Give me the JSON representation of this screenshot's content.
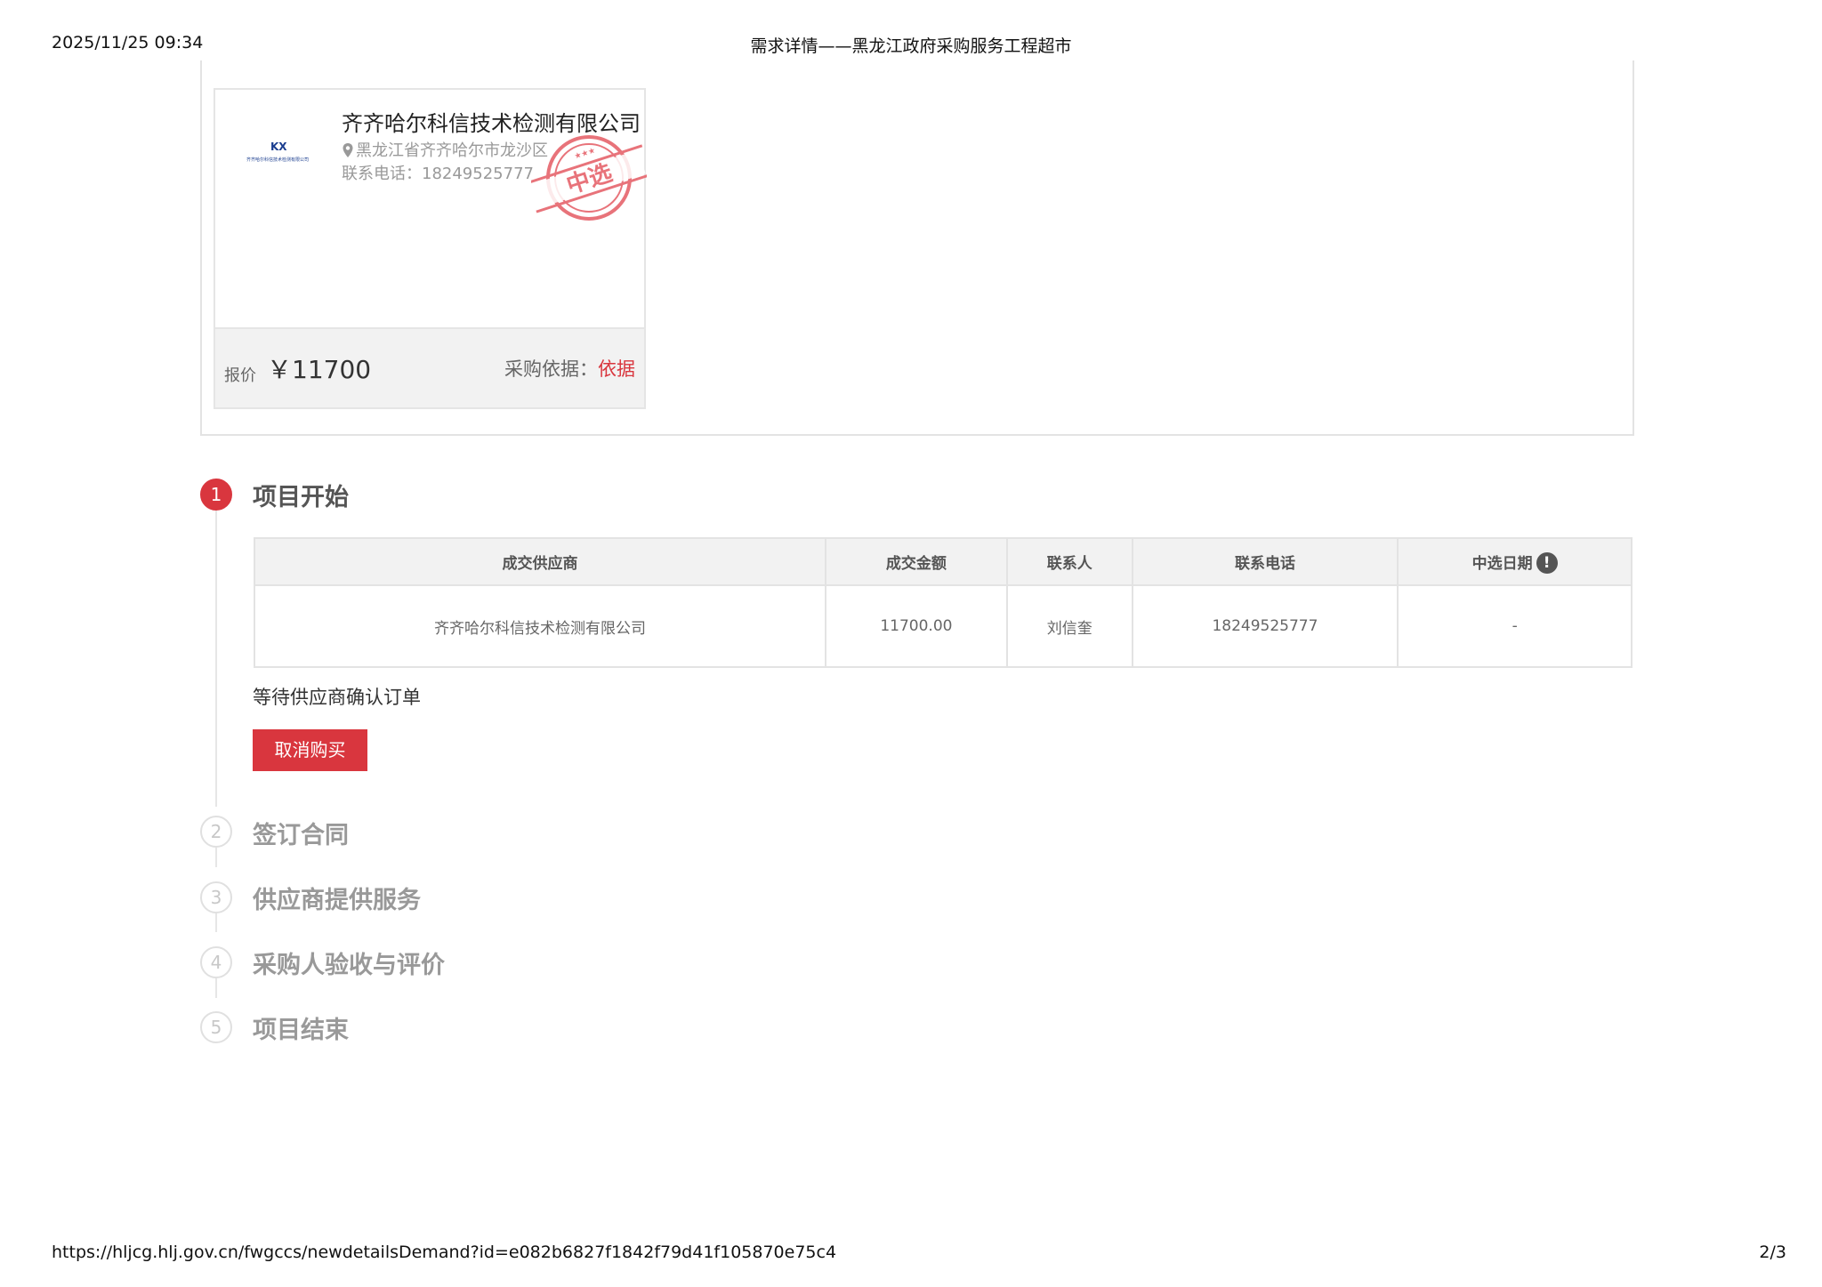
{
  "print_header": {
    "datetime": "2025/11/25 09:34",
    "title": "需求详情——黑龙江政府采购服务工程超市"
  },
  "print_footer": {
    "url": "https://hljcg.hlj.gov.cn/fwgccs/newdetailsDemand?id=e082b6827f1842f79d41f105870e75c4",
    "page": "2/3"
  },
  "supplier_card": {
    "logo_text": "KX",
    "logo_caption": "齐齐哈尔科信技术检测有限公司",
    "name": "齐齐哈尔科信技术检测有限公司",
    "address": "黑龙江省齐齐哈尔市龙沙区",
    "phone": "联系电话：18249525777",
    "stamp_text": "中选",
    "price_label": "报价",
    "price_value": "￥11700",
    "basis_label": "采购依据：",
    "basis_link": "依据"
  },
  "steps": [
    {
      "num": "1",
      "title": "项目开始",
      "active": true
    },
    {
      "num": "2",
      "title": "签订合同",
      "active": false
    },
    {
      "num": "3",
      "title": "供应商提供服务",
      "active": false
    },
    {
      "num": "4",
      "title": "采购人验收与评价",
      "active": false
    },
    {
      "num": "5",
      "title": "项目结束",
      "active": false
    }
  ],
  "deal_table": {
    "headers": [
      "成交供应商",
      "成交金额",
      "联系人",
      "联系电话",
      "中选日期"
    ],
    "info_icon": "!",
    "rows": [
      [
        "齐齐哈尔科信技术检测有限公司",
        "11700.00",
        "刘信奎",
        "18249525777",
        "-"
      ]
    ]
  },
  "status_text": "等待供应商确认订单",
  "cancel_button": "取消购买",
  "colors": {
    "accent": "#d9363e",
    "border": "#e3e3e3",
    "header_bg": "#f2f2f2"
  }
}
